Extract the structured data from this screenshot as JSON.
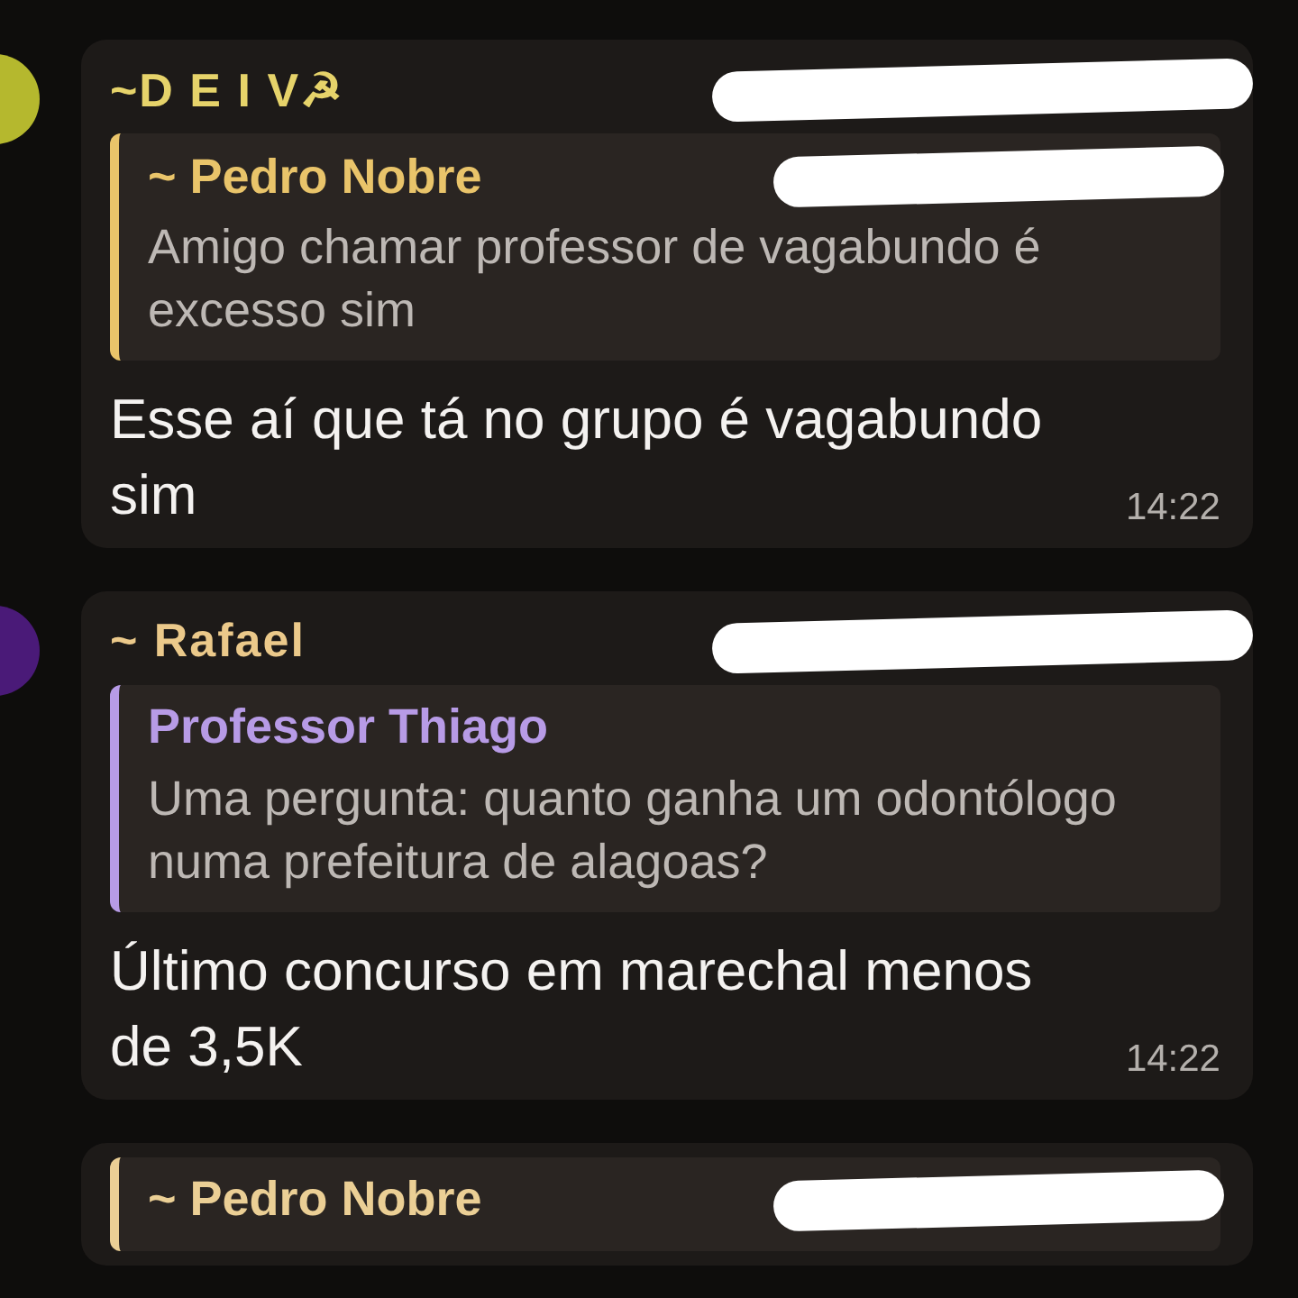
{
  "messages": [
    {
      "sender": {
        "name": "~D E I V☭",
        "color": "#e6d36a",
        "redacted": true
      },
      "avatar": true,
      "quote": {
        "author": "~ Pedro Nobre",
        "color": "#e9c46a",
        "redacted": true,
        "text": "Amigo chamar professor de vagabundo é excesso sim"
      },
      "text": "Esse aí que tá no grupo é vagabundo sim",
      "time": "14:22"
    },
    {
      "sender": {
        "name": "~ Rafael",
        "color": "#ebc98a",
        "redacted": true
      },
      "avatar": true,
      "quote": {
        "author": "Professor Thiago",
        "color": "#b79be6",
        "text": "Uma pergunta: quanto ganha um odontólogo numa prefeitura de alagoas?"
      },
      "text": "Último concurso em marechal menos de 3,5K",
      "time": "14:22"
    },
    {
      "quote": {
        "author": "~ Pedro Nobre",
        "color": "#ebcf95",
        "redacted": true
      }
    }
  ]
}
